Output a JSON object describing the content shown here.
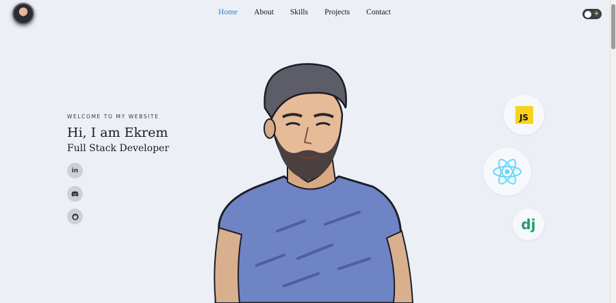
{
  "header": {
    "nav": [
      {
        "label": "Home",
        "active": true
      },
      {
        "label": "About",
        "active": false
      },
      {
        "label": "Skills",
        "active": false
      },
      {
        "label": "Projects",
        "active": false
      },
      {
        "label": "Contact",
        "active": false
      }
    ]
  },
  "hero": {
    "welcome": "WELCOME TO MY WEBSITE",
    "greeting": "Hi, I am Ekrem",
    "role": "Full Stack Developer"
  },
  "social": {
    "linkedin": "in",
    "discord": "discord-icon",
    "github": "github-icon"
  },
  "skills": {
    "js_label": "JS",
    "react_icon": "react-icon",
    "django_label": "dj"
  },
  "colors": {
    "background": "#ecf0f6",
    "accent": "#3a79c7",
    "js_yellow": "#f7d21f",
    "react_blue": "#61dafb",
    "django_green": "#1f9e6e",
    "toggle_dark": "#3a4250"
  }
}
